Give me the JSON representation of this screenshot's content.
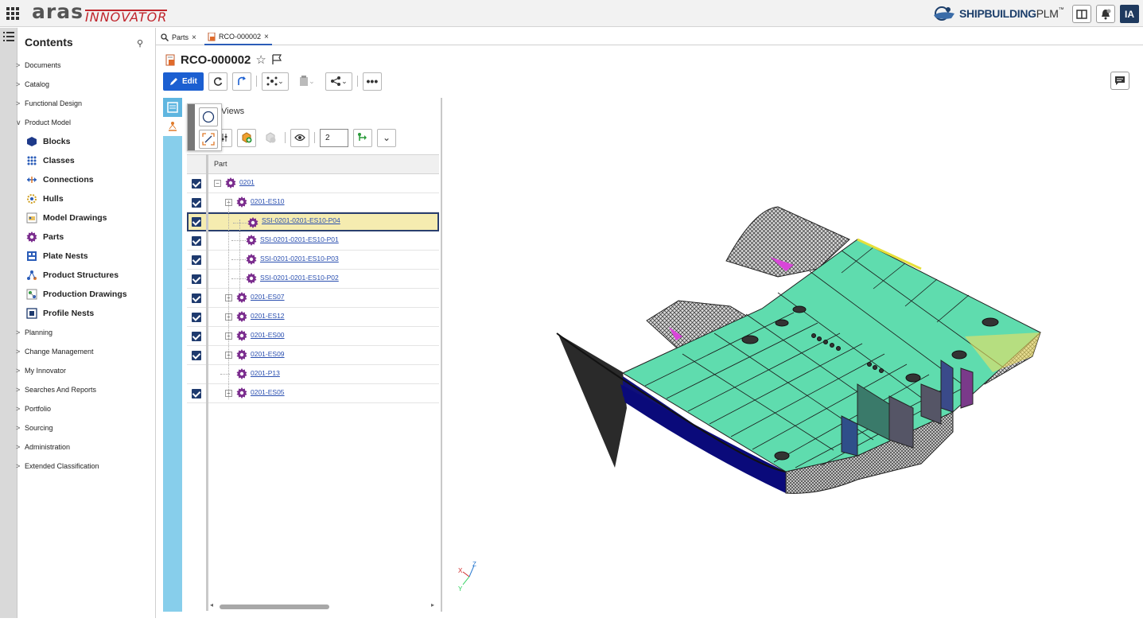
{
  "header": {
    "logo_main": "aras",
    "logo_sub": "INNOVATOR",
    "brand_bold": "SHIPBUILDING",
    "brand_light": "PLM",
    "brand_tm": "™",
    "avatar_initials": "IA"
  },
  "sidebar": {
    "title": "Contents",
    "items": [
      {
        "label": "Documents",
        "chevron": ">"
      },
      {
        "label": "Catalog",
        "chevron": ">"
      },
      {
        "label": "Functional Design",
        "chevron": ">"
      },
      {
        "label": "Product Model",
        "chevron": "∨"
      }
    ],
    "sub_items": [
      {
        "label": "Blocks",
        "icon": "hexagon-icon"
      },
      {
        "label": "Classes",
        "icon": "dots-grid-icon"
      },
      {
        "label": "Connections",
        "icon": "connections-icon"
      },
      {
        "label": "Hulls",
        "icon": "hull-icon"
      },
      {
        "label": "Model Drawings",
        "icon": "drawing-icon"
      },
      {
        "label": "Parts",
        "icon": "gear-icon"
      },
      {
        "label": "Plate Nests",
        "icon": "plate-nest-icon"
      },
      {
        "label": "Product Structures",
        "icon": "structure-icon"
      },
      {
        "label": "Production Drawings",
        "icon": "production-drawing-icon"
      },
      {
        "label": "Profile Nests",
        "icon": "profile-nest-icon"
      }
    ],
    "items_after": [
      {
        "label": "Planning",
        "chevron": ">"
      },
      {
        "label": "Change Management",
        "chevron": ">"
      },
      {
        "label": "My Innovator",
        "chevron": ">"
      },
      {
        "label": "Searches And Reports",
        "chevron": ">"
      },
      {
        "label": "Portfolio",
        "chevron": ">"
      },
      {
        "label": "Sourcing",
        "chevron": ">"
      },
      {
        "label": "Administration",
        "chevron": ">"
      },
      {
        "label": "Extended Classification",
        "chevron": ">"
      }
    ]
  },
  "tabs": [
    {
      "label": "Parts",
      "close": "×",
      "icon": "search-icon"
    },
    {
      "label": "RCO-000002",
      "close": "×",
      "icon": "document-icon"
    }
  ],
  "item": {
    "title": "RCO-000002",
    "edit_label": "Edit"
  },
  "panel": {
    "views_label": "Views",
    "level_value": "2",
    "column_part": "Part"
  },
  "tree_rows": [
    {
      "name": "0201",
      "checked": true,
      "depth": 0,
      "expander": "−"
    },
    {
      "name": "0201-ES10",
      "checked": true,
      "depth": 1,
      "expander": "−"
    },
    {
      "name": "SSI-0201-0201-ES10-P04",
      "checked": true,
      "depth": 2,
      "expander": "",
      "selected": true
    },
    {
      "name": "SSI-0201-0201-ES10-P01",
      "checked": true,
      "depth": 2,
      "expander": ""
    },
    {
      "name": "SSI-0201-0201-ES10-P03",
      "checked": true,
      "depth": 2,
      "expander": ""
    },
    {
      "name": "SSI-0201-0201-ES10-P02",
      "checked": true,
      "depth": 2,
      "expander": ""
    },
    {
      "name": "0201-ES07",
      "checked": true,
      "depth": 1,
      "expander": "+"
    },
    {
      "name": "0201-ES12",
      "checked": true,
      "depth": 1,
      "expander": "+"
    },
    {
      "name": "0201-ES00",
      "checked": true,
      "depth": 1,
      "expander": "+"
    },
    {
      "name": "0201-ES09",
      "checked": true,
      "depth": 1,
      "expander": "+"
    },
    {
      "name": "0201-P13",
      "checked": false,
      "depth": 1,
      "expander": ""
    },
    {
      "name": "0201-ES05",
      "checked": true,
      "depth": 1,
      "expander": "+"
    }
  ],
  "axis": {
    "x": "X",
    "y": "Y",
    "z": "Z"
  },
  "colors": {
    "accent": "#1b5fd1",
    "rail": "#87ceeb",
    "deck": "#5fdcae",
    "hull": "#0a0a7a",
    "gear": "#7b2d8e",
    "selected_row": "#f5ecb0"
  }
}
